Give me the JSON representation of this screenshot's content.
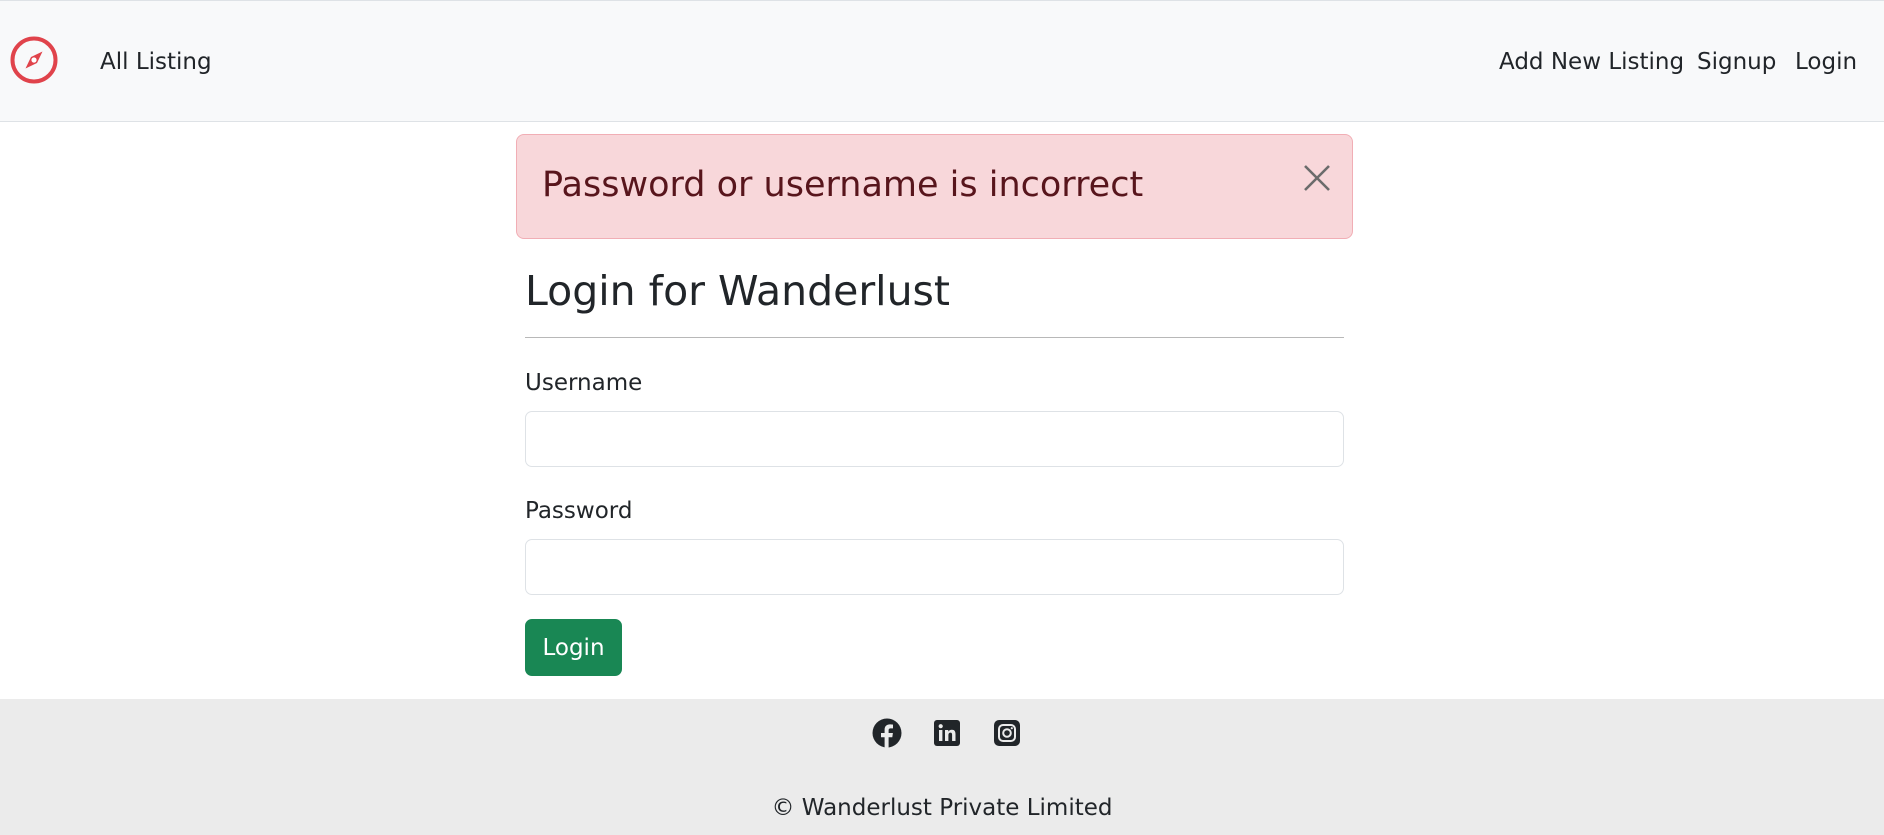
{
  "navbar": {
    "brand_icon": "compass-icon",
    "brand_color": "#e0434b",
    "left_links": [
      {
        "label": "All Listing"
      }
    ],
    "right_links": [
      {
        "label": "Add New Listing"
      },
      {
        "label": "Signup"
      },
      {
        "label": "Login"
      }
    ]
  },
  "alert": {
    "message": "Password or username is incorrect",
    "close_icon": "close-icon",
    "background": "#f8d7da",
    "text_color": "#58151c"
  },
  "form": {
    "title": "Login for Wanderlust",
    "username_label": "Username",
    "username_value": "",
    "password_label": "Password",
    "password_value": "",
    "submit_label": "Login",
    "submit_color": "#198754"
  },
  "footer": {
    "social_icons": [
      "facebook-icon",
      "linkedin-icon",
      "instagram-icon"
    ],
    "copyright": "© Wanderlust Private Limited"
  }
}
